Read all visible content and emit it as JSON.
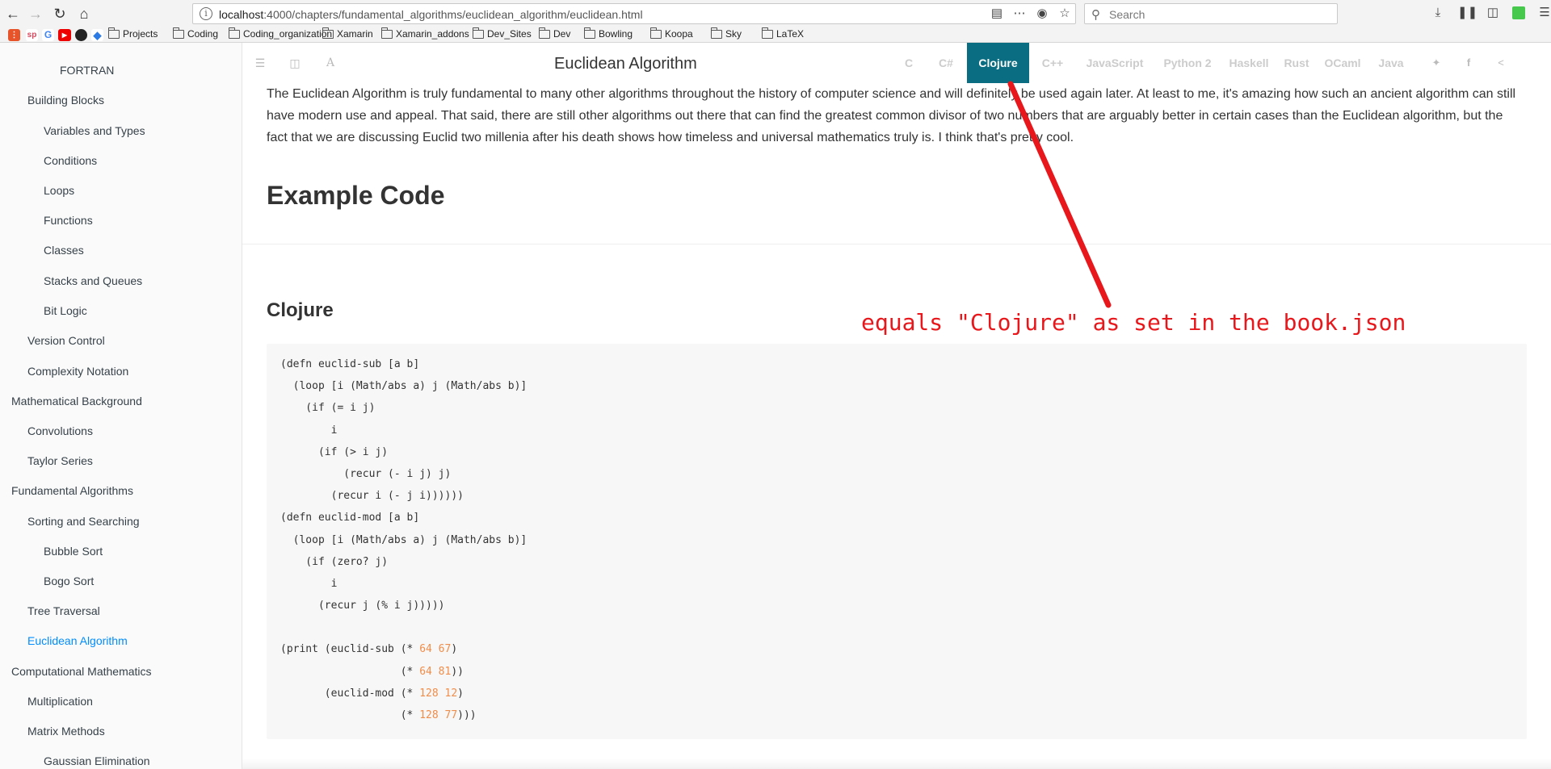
{
  "browser": {
    "url_host": "localhost",
    "url_path": ":4000/chapters/fundamental_algorithms/euclidean_algorithm/euclidean.html",
    "search_placeholder": "Search",
    "bookmarks": [
      {
        "label": "Projects"
      },
      {
        "label": "Coding"
      },
      {
        "label": "Coding_organization"
      },
      {
        "label": "Xamarin"
      },
      {
        "label": "Xamarin_addons"
      },
      {
        "label": "Dev_Sites"
      },
      {
        "label": "Dev"
      },
      {
        "label": "Bowling"
      },
      {
        "label": "Koopa"
      },
      {
        "label": "Sky"
      },
      {
        "label": "LaTeX"
      }
    ]
  },
  "sidebar": {
    "items": [
      {
        "label": "FORTRAN"
      },
      {
        "label": "Building Blocks"
      },
      {
        "label": "Variables and Types"
      },
      {
        "label": "Conditions"
      },
      {
        "label": "Loops"
      },
      {
        "label": "Functions"
      },
      {
        "label": "Classes"
      },
      {
        "label": "Stacks and Queues"
      },
      {
        "label": "Bit Logic"
      },
      {
        "label": "Version Control"
      },
      {
        "label": "Complexity Notation"
      },
      {
        "label": "Mathematical Background"
      },
      {
        "label": "Convolutions"
      },
      {
        "label": "Taylor Series"
      },
      {
        "label": "Fundamental Algorithms"
      },
      {
        "label": "Sorting and Searching"
      },
      {
        "label": "Bubble Sort"
      },
      {
        "label": "Bogo Sort"
      },
      {
        "label": "Tree Traversal"
      },
      {
        "label": "Euclidean Algorithm"
      },
      {
        "label": "Computational Mathematics"
      },
      {
        "label": "Multiplication"
      },
      {
        "label": "Matrix Methods"
      },
      {
        "label": "Gaussian Elimination"
      }
    ],
    "active_color": "#008cff"
  },
  "header": {
    "title": "Euclidean Algorithm",
    "languages": [
      "C",
      "C#",
      "Clojure",
      "C++",
      "JavaScript",
      "Python 2",
      "Haskell",
      "Rust",
      "OCaml",
      "Java"
    ],
    "active_language": "Clojure",
    "active_color": "#0a6d81"
  },
  "content": {
    "intro": "The Euclidean Algorithm is truly fundamental to many other algorithms throughout the history of computer science and will definitely be used again later. At least to me, it's amazing how such an ancient algorithm can still have modern use and appeal. That said, there are still other algorithms out there that can find the greatest common divisor of two numbers that are arguably better in certain cases than the Euclidean algorithm, but the fact that we are discussing Euclid two millenia after his death shows how timeless and universal mathematics truly is. I think that's pretty cool.",
    "example_heading": "Example Code",
    "language_heading": "Clojure",
    "code_lines": [
      "(defn euclid-sub [a b]",
      "  (loop [i (Math/abs a) j (Math/abs b)]",
      "    (if (= i j)",
      "        i",
      "      (if (> i j)",
      "          (recur (- i j) j)",
      "        (recur i (- j i))))))",
      "(defn euclid-mod [a b]",
      "  (loop [i (Math/abs a) j (Math/abs b)]",
      "    (if (zero? j)",
      "        i",
      "      (recur j (% i j)))))",
      "",
      "(print (euclid-sub (* 64 67)",
      "                   (* 64 81))",
      "       (euclid-mod (* 128 12)",
      "                   (* 128 77)))"
    ]
  },
  "annotation": {
    "text": "equals \"Clojure\" as set in the book.json",
    "color": "#e8171b"
  }
}
